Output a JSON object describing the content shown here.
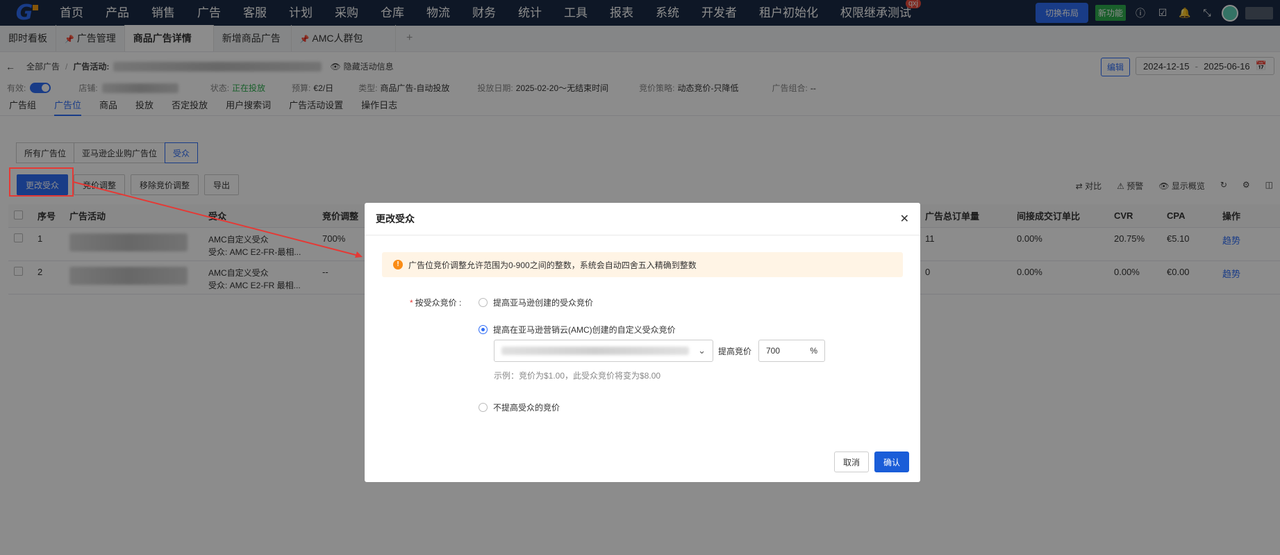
{
  "nav": {
    "menu": [
      "首页",
      "产品",
      "销售",
      "广告",
      "客服",
      "计划",
      "采购",
      "仓库",
      "物流",
      "财务",
      "统计",
      "工具",
      "报表",
      "系统",
      "开发者",
      "租户初始化",
      "权限继承测试"
    ],
    "qxj_badge": "qxj",
    "switch_layout": "切换布局",
    "new_feature": "新功能"
  },
  "tabs": [
    {
      "label": "即时看板"
    },
    {
      "label": "广告管理"
    },
    {
      "label": "商品广告详情"
    },
    {
      "label": "新增商品广告"
    },
    {
      "label": "AMC人群包"
    }
  ],
  "header": {
    "crumb_all": "全部广告",
    "crumb_campaign_label": "广告活动:",
    "hide_info": "隐藏活动信息",
    "edit": "编辑",
    "date_start": "2024-12-15",
    "date_sep": "-",
    "date_end": "2025-06-16"
  },
  "info": {
    "valid_label": "有效:",
    "store_label": "店铺:",
    "status_label": "状态:",
    "status_value": "正在投放",
    "budget_label": "预算:",
    "budget_value": "€2/日",
    "type_label": "类型:",
    "type_value": "商品广告-自动投放",
    "date_label": "投放日期:",
    "date_value": "2025-02-20～无结束时间",
    "strategy_label": "竞价策略:",
    "strategy_value": "动态竞价-只降低",
    "portfolio_label": "广告组合:",
    "portfolio_value": "--"
  },
  "subtabs": [
    "广告组",
    "广告位",
    "商品",
    "投放",
    "否定投放",
    "用户搜索词",
    "广告活动设置",
    "操作日志"
  ],
  "segments": [
    "所有广告位",
    "亚马逊企业购广告位",
    "受众"
  ],
  "actions": [
    "更改受众",
    "竞价调整",
    "移除竞价调整",
    "导出"
  ],
  "tools": [
    "对比",
    "预警",
    "显示概览"
  ],
  "table": {
    "left_headers": [
      "序号",
      "广告活动",
      "受众",
      "竞价调整"
    ],
    "right_headers": [
      "广告总订单量",
      "间接成交订单比",
      "CVR",
      "CPA",
      "操作"
    ],
    "rows": [
      {
        "no": "1",
        "audience": "AMC自定义受众",
        "audience_sub": "受众: AMC E2-FR-最相...",
        "bid": "700%",
        "orders": "11",
        "indirect": "0.00%",
        "cvr": "20.75%",
        "cpa": "€5.10",
        "op": "趋势"
      },
      {
        "no": "2",
        "audience": "AMC自定义受众",
        "audience_sub": "受众: AMC E2-FR 最相...",
        "bid": "--",
        "orders": "0",
        "indirect": "0.00%",
        "cvr": "0.00%",
        "cpa": "€0.00",
        "op": "趋势"
      }
    ]
  },
  "modal": {
    "title": "更改受众",
    "alert": "广告位竞价调整允许范围为0-900之间的整数，系统会自动四舍五入精确到整数",
    "label": "按受众竞价 :",
    "option1": "提高亚马逊创建的受众竞价",
    "option2": "提高在亚马逊营销云(AMC)创建的自定义受众竞价",
    "option3": "不提高受众的竞价",
    "bid_label": "提高竞价",
    "bid_value": "700",
    "bid_unit": "%",
    "example": "示例：竞价为$1.00，此受众竞价将变为$8.00",
    "cancel": "取消",
    "confirm": "确认"
  },
  "colors": {
    "primary": "#2f6df6",
    "nav_bg": "#1b2b45",
    "warning_bg": "#fff4e5",
    "annotation_red": "#e53935"
  }
}
